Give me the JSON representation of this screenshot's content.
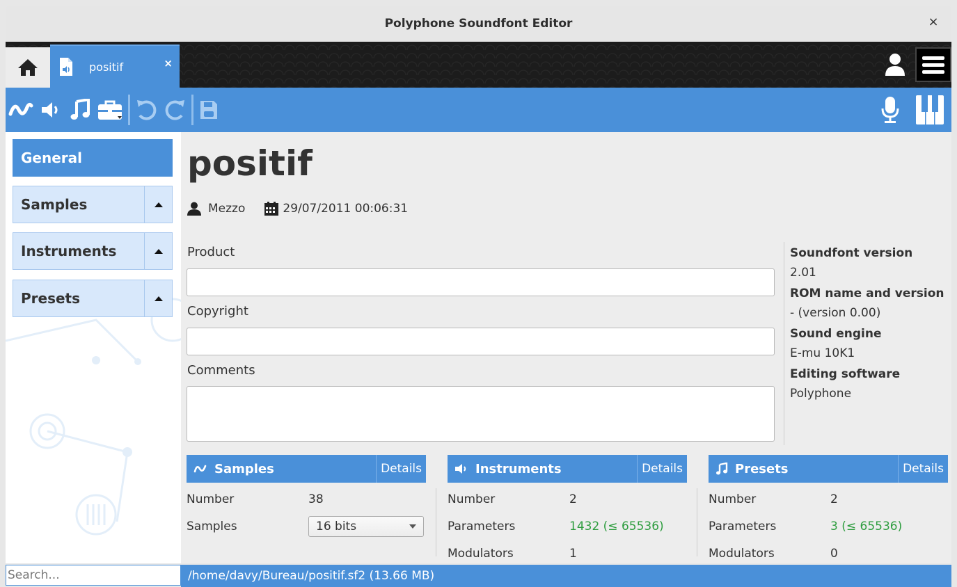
{
  "window": {
    "title": "Polyphone Soundfont Editor",
    "close_glyph": "×"
  },
  "tabs": {
    "home_icon": "home-icon",
    "document_tab": {
      "label": "positif",
      "close_glyph": "×"
    }
  },
  "toolbar": {
    "left_icons": [
      "waveform-icon",
      "speaker-icon",
      "music-note-icon",
      "toolbox-icon"
    ],
    "edit_icons": [
      "undo-icon",
      "redo-icon",
      "save-icon"
    ],
    "right_icons": [
      "microphone-icon",
      "piano-icon"
    ]
  },
  "sidebar": {
    "items": [
      {
        "label": "General",
        "active": true
      },
      {
        "label": "Samples",
        "active": false
      },
      {
        "label": "Instruments",
        "active": false
      },
      {
        "label": "Presets",
        "active": false
      }
    ],
    "search_placeholder": "Search..."
  },
  "main": {
    "title": "positif",
    "author": "Mezzo",
    "date": "29/07/2011 00:06:31",
    "fields": {
      "product_label": "Product",
      "product_value": "",
      "copyright_label": "Copyright",
      "copyright_value": "",
      "comments_label": "Comments",
      "comments_value": ""
    },
    "info": [
      {
        "key": "Soundfont version",
        "value": "2.01"
      },
      {
        "key": "ROM name and version",
        "value": "- (version 0.00)"
      },
      {
        "key": "Sound engine",
        "value": "E-mu 10K1"
      },
      {
        "key": "Editing software",
        "value": "Polyphone"
      }
    ],
    "panels": {
      "samples": {
        "title": "Samples",
        "details": "Details",
        "rows": [
          {
            "key": "Number",
            "value": "38"
          },
          {
            "key": "Samples",
            "value": "16 bits"
          }
        ]
      },
      "instruments": {
        "title": "Instruments",
        "details": "Details",
        "rows": [
          {
            "key": "Number",
            "value": "2"
          },
          {
            "key": "Parameters",
            "value": "1432 (≤ 65536)"
          },
          {
            "key": "Modulators",
            "value": "1"
          }
        ]
      },
      "presets": {
        "title": "Presets",
        "details": "Details",
        "rows": [
          {
            "key": "Number",
            "value": "2"
          },
          {
            "key": "Parameters",
            "value": "3 (≤ 65536)"
          },
          {
            "key": "Modulators",
            "value": "0"
          }
        ]
      }
    }
  },
  "status": {
    "path": "/home/davy/Bureau/positif.sf2 (13.66 MB)"
  },
  "colors": {
    "accent": "#4a90d9",
    "accent_light": "#d8e8fb",
    "ok_green": "#2e9d3f"
  }
}
